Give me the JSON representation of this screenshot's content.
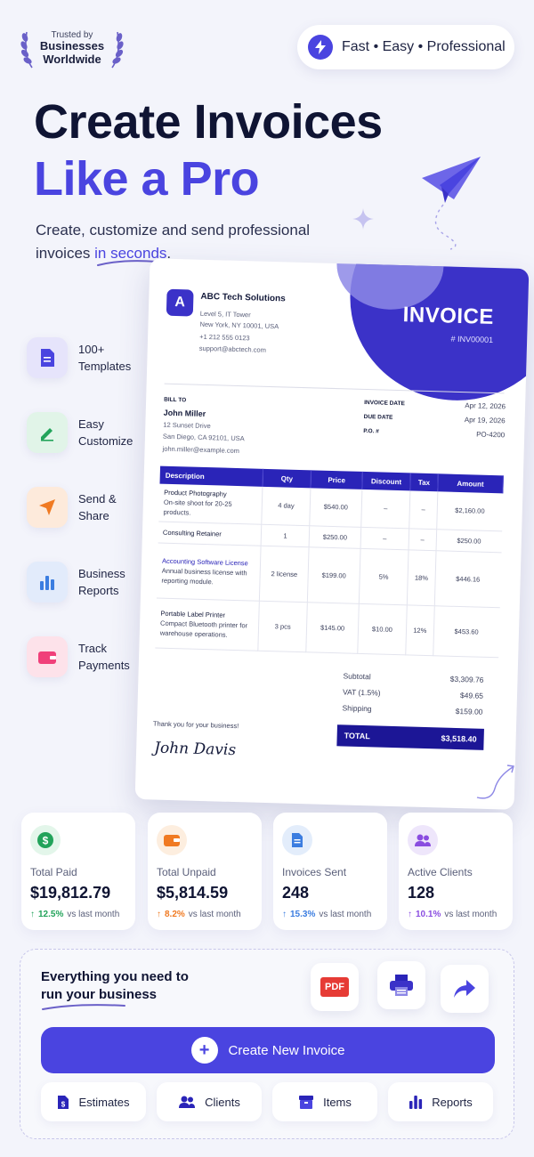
{
  "badge": {
    "trusted_by": "Trusted by",
    "businesses": "Businesses",
    "worldwide": "Worldwide"
  },
  "pill": {
    "text": "Fast • Easy • Professional"
  },
  "hero": {
    "line1": "Create Invoices",
    "line2": "Like a Pro",
    "subtitle_1": "Create, customize and send professional",
    "subtitle_2": "invoices ",
    "subtitle_highlight": "in seconds",
    "subtitle_end": "."
  },
  "features": [
    {
      "label": "100+\nTemplates",
      "icon": "document-icon",
      "color": "#4a44e0"
    },
    {
      "label": "Easy\nCustomize",
      "icon": "pencil-icon",
      "color": "#22a35a"
    },
    {
      "label": "Send &\nShare",
      "icon": "paper-plane-icon",
      "color": "#f07a22"
    },
    {
      "label": "Business\nReports",
      "icon": "bar-chart-icon",
      "color": "#3b7de0"
    },
    {
      "label": "Track\nPayments",
      "icon": "wallet-icon",
      "color": "#f0407a"
    }
  ],
  "invoice": {
    "logo_letter": "A",
    "company": "ABC Tech Solutions",
    "address_1": "Level 5, IT Tower",
    "address_2": "New York, NY 10001, USA",
    "phone": "+1 212 555 0123",
    "email": "support@abctech.com",
    "title": "INVOICE",
    "number": "# INV00001",
    "bill_to_label": "BILL TO",
    "client_name": "John Miller",
    "client_address_1": "12 Sunset Drive",
    "client_address_2": "San Diego, CA 92101, USA",
    "client_email": "john.miller@example.com",
    "invoice_date_label": "INVOICE DATE",
    "invoice_date": "Apr 12, 2026",
    "due_date_label": "DUE DATE",
    "due_date": "Apr 19, 2026",
    "po_label": "P.O. #",
    "po": "PO-4200",
    "columns": [
      "Description",
      "Qty",
      "Price",
      "Discount",
      "Tax",
      "Amount"
    ],
    "rows": [
      {
        "name": "Product Photography",
        "desc": "On-site shoot for 20-25 products.",
        "qty": "4 day",
        "price": "$540.00",
        "discount": "–",
        "tax": "–",
        "amount": "$2,160.00"
      },
      {
        "name": "Consulting Retainer",
        "desc": "",
        "qty": "1",
        "price": "$250.00",
        "discount": "–",
        "tax": "–",
        "amount": "$250.00"
      },
      {
        "name": "Accounting Software License",
        "desc": "Annual business license with reporting module.",
        "qty": "2 license",
        "price": "$199.00",
        "discount": "5%",
        "tax": "18%",
        "amount": "$446.16"
      },
      {
        "name": "Portable Label Printer",
        "desc": "Compact Bluetooth printer for warehouse operations.",
        "qty": "3 pcs",
        "price": "$145.00",
        "discount": "$10.00",
        "tax": "12%",
        "amount": "$453.60"
      }
    ],
    "subtotal_label": "Subtotal",
    "subtotal": "$3,309.76",
    "vat_label": "VAT (1.5%)",
    "vat": "$49.65",
    "shipping_label": "Shipping",
    "shipping": "$159.00",
    "total_label": "TOTAL",
    "total": "$3,518.40",
    "thanks": "Thank you for your business!",
    "signature": "John Davis"
  },
  "stats": [
    {
      "label": "Total Paid",
      "value": "$19,812.79",
      "pct": "12.5%",
      "suffix": "vs last month",
      "icon": "dollar-icon",
      "color": "#22a35a",
      "bg": "#e3f6ea"
    },
    {
      "label": "Total Unpaid",
      "value": "$5,814.59",
      "pct": "8.2%",
      "suffix": "vs last month",
      "icon": "wallet-icon",
      "color": "#f07a22",
      "bg": "#fdeedf"
    },
    {
      "label": "Invoices Sent",
      "value": "248",
      "pct": "15.3%",
      "suffix": "vs last month",
      "icon": "document-icon",
      "color": "#3b7de0",
      "bg": "#e3edfb"
    },
    {
      "label": "Active Clients",
      "value": "128",
      "pct": "10.1%",
      "suffix": "vs last month",
      "icon": "users-icon",
      "color": "#8a4de0",
      "bg": "#eee6fb"
    }
  ],
  "panel": {
    "tagline_1": "Everything you need to",
    "tagline_2": "run your business",
    "pdf_label": "PDF",
    "create_label": "Create New Invoice",
    "buttons": [
      {
        "label": "Estimates",
        "icon": "dollar-doc-icon"
      },
      {
        "label": "Clients",
        "icon": "users-icon"
      },
      {
        "label": "Items",
        "icon": "box-icon"
      },
      {
        "label": "Reports",
        "icon": "bar-chart-icon"
      }
    ]
  },
  "colors": {
    "accent": "#4a44e0",
    "dark_navy": "#0f1433",
    "invoice_blue": "#2a24b8"
  }
}
